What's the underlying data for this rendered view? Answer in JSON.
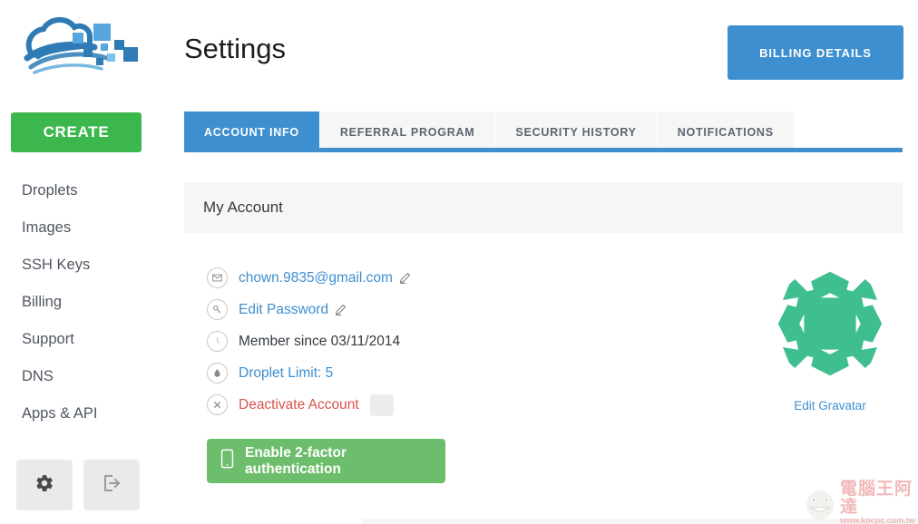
{
  "sidebar": {
    "logo_name": "cloud-pixel-logo",
    "create_label": "CREATE",
    "items": [
      {
        "label": "Droplets",
        "name": "droplets"
      },
      {
        "label": "Images",
        "name": "images"
      },
      {
        "label": "SSH Keys",
        "name": "ssh-keys"
      },
      {
        "label": "Billing",
        "name": "billing"
      },
      {
        "label": "Support",
        "name": "support"
      },
      {
        "label": "DNS",
        "name": "dns"
      },
      {
        "label": "Apps & API",
        "name": "apps-api"
      }
    ],
    "footer": {
      "settings_icon": "gear-icon",
      "logout_icon": "logout-icon"
    }
  },
  "header": {
    "title": "Settings",
    "billing_button_label": "BILLING DETAILS"
  },
  "tabs": [
    {
      "label": "ACCOUNT INFO",
      "name": "account-info",
      "active": true
    },
    {
      "label": "REFERRAL PROGRAM",
      "name": "referral-program",
      "active": false
    },
    {
      "label": "SECURITY HISTORY",
      "name": "security-history",
      "active": false
    },
    {
      "label": "NOTIFICATIONS",
      "name": "notifications",
      "active": false
    }
  ],
  "account": {
    "section_title": "My Account",
    "rows": [
      {
        "icon": "envelope-icon",
        "label": "chown.9835@gmail.com",
        "style": "link",
        "edit": true
      },
      {
        "icon": "key-icon",
        "label": "Edit Password",
        "style": "link",
        "edit": true
      },
      {
        "icon": "clock-icon",
        "label": "Member since 03/11/2014",
        "style": "plain",
        "edit": false
      },
      {
        "icon": "droplet-icon",
        "label": "Droplet Limit: 5",
        "style": "link",
        "edit": false
      },
      {
        "icon": "x-circle-icon",
        "label": "Deactivate Account",
        "style": "danger",
        "edit": false
      }
    ],
    "twofactor_label": "Enable 2-factor authentication",
    "twofactor_icon": "mobile-phone-icon"
  },
  "gravatar": {
    "image_name": "gravatar-identicon",
    "edit_label": "Edit Gravatar"
  },
  "watermark": {
    "text_cn": "電腦王阿達",
    "url": "www.kocpc.com.tw"
  },
  "colors": {
    "accent_blue": "#3e8fd0",
    "create_green": "#3cb74e",
    "button_green": "#6cbe6c",
    "danger_red": "#d9534f",
    "gravatar_green": "#3fbf8f"
  }
}
